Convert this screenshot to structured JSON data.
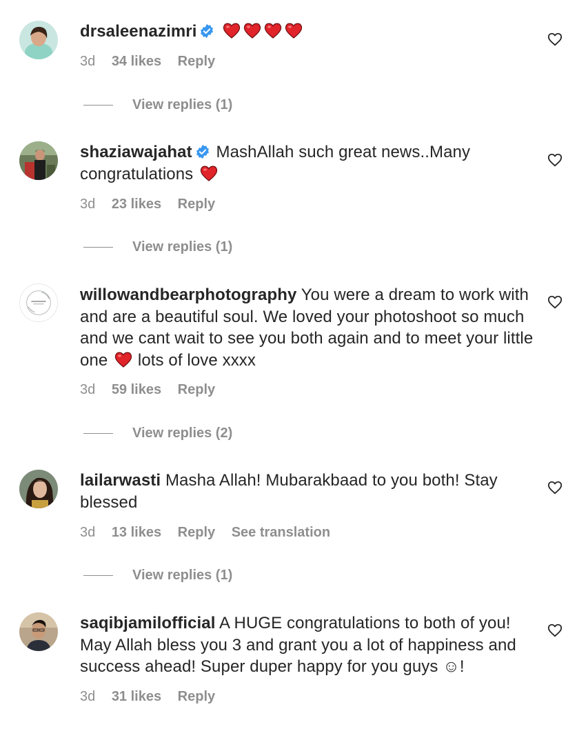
{
  "comments": [
    {
      "username": "drsaleenazimri",
      "verified": true,
      "text": "",
      "time": "3d",
      "likes": "34 likes",
      "reply": "Reply",
      "translate": "",
      "view_replies": "View replies (1)"
    },
    {
      "username": "shaziawajahat",
      "verified": true,
      "text": "MashAllah such great news..Many congratulations",
      "time": "3d",
      "likes": "23 likes",
      "reply": "Reply",
      "translate": "",
      "view_replies": "View replies (1)"
    },
    {
      "username": "willowandbearphotography",
      "verified": false,
      "text_part1": "You were a dream to work with and are a beautiful soul. We loved your photoshoot so much and we cant wait to see you both again and to meet your little one",
      "text_part2": "lots of love xxxx",
      "time": "3d",
      "likes": "59 likes",
      "reply": "Reply",
      "translate": "",
      "view_replies": "View replies (2)"
    },
    {
      "username": "lailarwasti",
      "verified": false,
      "text": "Masha Allah! Mubarakbaad to you both! Stay blessed",
      "time": "3d",
      "likes": "13 likes",
      "reply": "Reply",
      "translate": "See translation",
      "view_replies": "View replies (1)"
    },
    {
      "username": "saqibjamilofficial",
      "verified": false,
      "text": "A HUGE congratulations to both of you! May Allah bless you 3 and grant you a lot of happiness and success ahead! Super duper happy for you guys ☺!",
      "time": "3d",
      "likes": "31 likes",
      "reply": "Reply",
      "translate": "",
      "view_replies": ""
    }
  ],
  "icons": {
    "like": "heart-outline-icon",
    "verified": "verified-badge-icon",
    "emoji": "red-heart-emoji"
  },
  "colors": {
    "text": "#262626",
    "muted": "#8e8e8e",
    "verified": "#3897f0",
    "emoji_heart": "#e0242a"
  }
}
